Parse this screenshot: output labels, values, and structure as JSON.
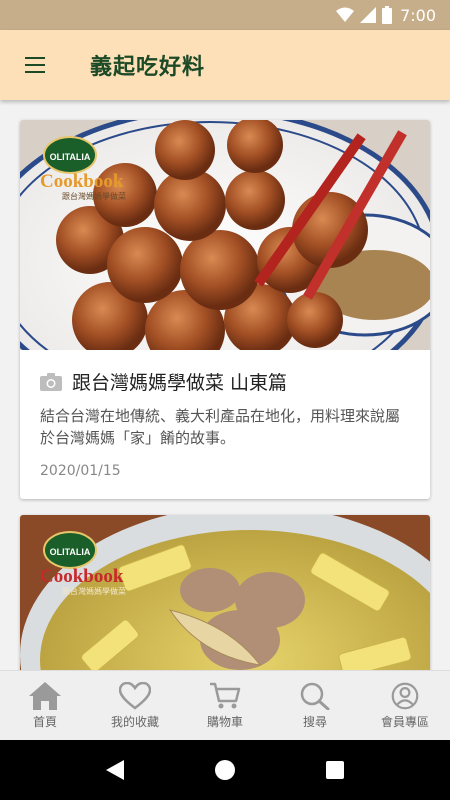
{
  "status_bar": {
    "time": "7:00"
  },
  "app_bar": {
    "title": "義起吃好料",
    "menu_icon": "hamburger-menu-icon"
  },
  "feed": {
    "cards": [
      {
        "brand": "OLITALIA",
        "cookbook": "Cookbook",
        "cookbook_sub": "跟台灣媽媽學做菜",
        "title": "跟台灣媽媽學做菜 山東篇",
        "description": "結合台灣在地傳統、義大利產品在地化，用料理來說屬於台灣媽媽「家」餚的故事。",
        "date": "2020/01/15",
        "icon": "camera-icon"
      },
      {
        "brand": "OLITALIA",
        "cookbook": "Cookbook",
        "cookbook_sub": "跟台灣媽媽學做菜"
      }
    ]
  },
  "bottom_nav": {
    "items": [
      {
        "label": "首頁",
        "icon": "home-icon"
      },
      {
        "label": "我的收藏",
        "icon": "heart-icon"
      },
      {
        "label": "購物車",
        "icon": "cart-icon"
      },
      {
        "label": "搜尋",
        "icon": "search-icon"
      },
      {
        "label": "會員專區",
        "icon": "user-icon"
      }
    ]
  },
  "colors": {
    "status_bar": "#c7ae8b",
    "app_bar": "#fde0b8",
    "title_green": "#1c4a26",
    "nav_icon": "#9a9a9a"
  }
}
